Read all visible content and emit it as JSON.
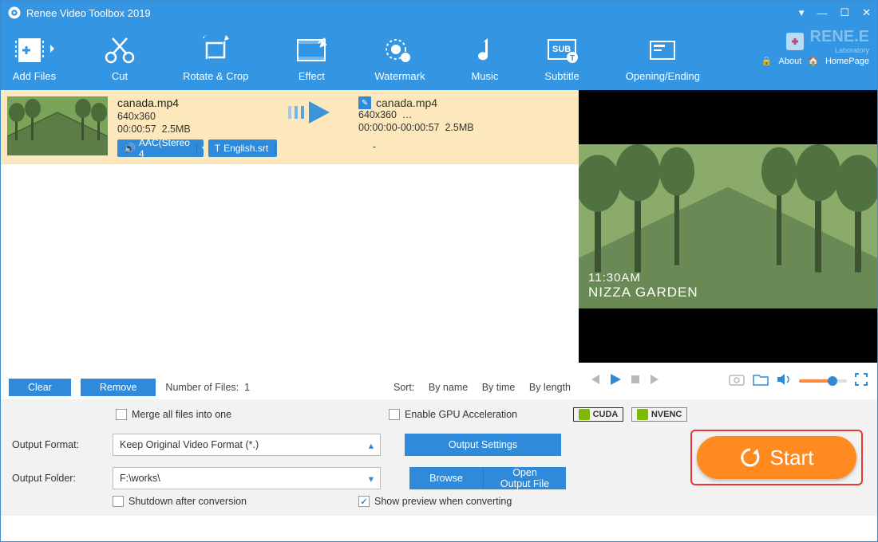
{
  "app": {
    "title": "Renee Video Toolbox 2019"
  },
  "brand": {
    "name": "RENE.E",
    "sub": "Laboratory",
    "about": "About",
    "home": "HomePage"
  },
  "toolbar": {
    "items": [
      {
        "label": "Add Files"
      },
      {
        "label": "Cut"
      },
      {
        "label": "Rotate & Crop"
      },
      {
        "label": "Effect"
      },
      {
        "label": "Watermark"
      },
      {
        "label": "Music"
      },
      {
        "label": "Subtitle"
      },
      {
        "label": "Opening/Ending"
      }
    ]
  },
  "file": {
    "name": "canada.mp4",
    "resolution": "640x360",
    "duration": "00:00:57",
    "size": "2.5MB",
    "audio_pill": "AAC(Stereo 4",
    "sub_pill": "English.srt",
    "out_name": "canada.mp4",
    "out_resolution": "640x360",
    "out_range": "00:00:00-00:00:57",
    "out_size": "2.5MB",
    "placeholder": "-"
  },
  "overlay": {
    "time": "11:30AM",
    "title": "NIZZA GARDEN"
  },
  "sortrow": {
    "clear": "Clear",
    "remove": "Remove",
    "count_label": "Number of Files:",
    "count": "1",
    "sort_label": "Sort:",
    "by_name": "By name",
    "by_time": "By time",
    "by_length": "By length"
  },
  "bottom": {
    "merge": "Merge all files into one",
    "gpu": "Enable GPU Acceleration",
    "cuda": "CUDA",
    "nvenc": "NVENC",
    "out_format_label": "Output Format:",
    "out_format": "Keep Original Video Format (*.)",
    "out_settings": "Output Settings",
    "out_folder_label": "Output Folder:",
    "out_folder": "F:\\works\\",
    "browse": "Browse",
    "open_out": "Open Output File",
    "shutdown": "Shutdown after conversion",
    "show_preview": "Show preview when converting",
    "start": "Start"
  }
}
